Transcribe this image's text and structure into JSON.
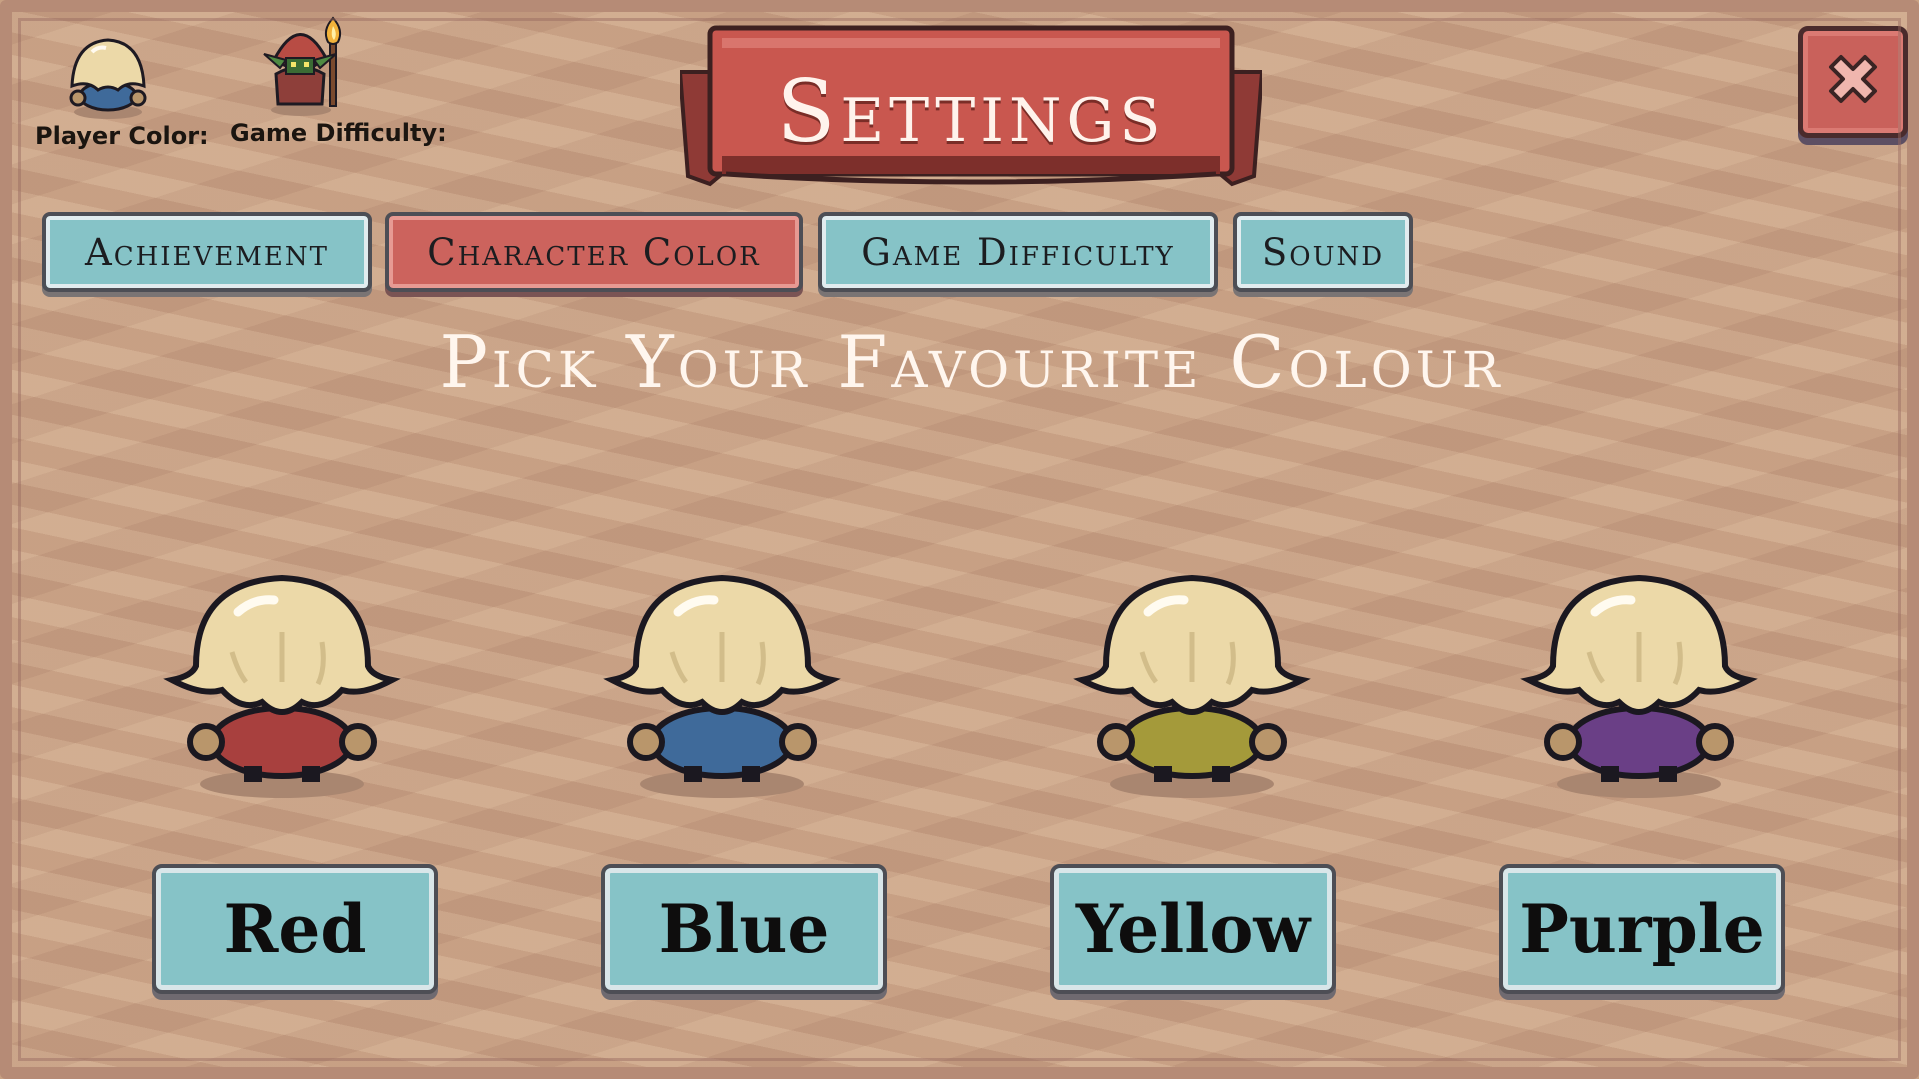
{
  "status": {
    "player_color_label": "Player Color:",
    "game_difficulty_label": "Game Difficulty:"
  },
  "title": "Settings",
  "tabs": [
    {
      "label": "Achievement",
      "active": false
    },
    {
      "label": "Character Color",
      "active": true
    },
    {
      "label": "Game Difficulty",
      "active": false
    },
    {
      "label": "Sound",
      "active": false
    }
  ],
  "heading": "Pick Your Favourite Colour",
  "colors": [
    {
      "label": "Red",
      "body_hex": "#a8403e"
    },
    {
      "label": "Blue",
      "body_hex": "#3f6a9a"
    },
    {
      "label": "Yellow",
      "body_hex": "#a49a3a"
    },
    {
      "label": "Purple",
      "body_hex": "#6a3f86"
    }
  ],
  "current_player_body_hex": "#3f6a9a",
  "icons": {
    "close": "close-x-icon",
    "player": "player-character-icon",
    "difficulty": "goblin-torch-icon"
  },
  "theme": {
    "board": "#c9a286",
    "tab_teal": "#86c3c7",
    "tab_active_red": "#cc635d",
    "banner_red": "#c9574f"
  }
}
